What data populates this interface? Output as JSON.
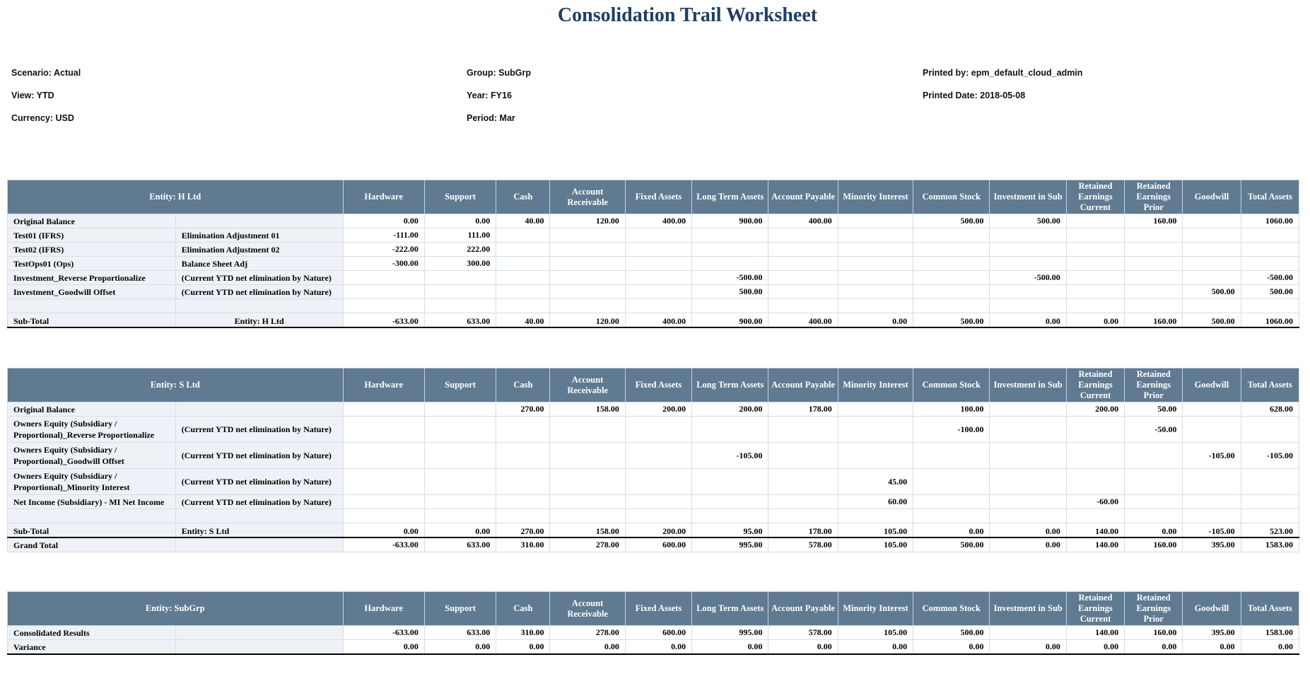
{
  "title": "Consolidation Trail Worksheet",
  "header": {
    "scenario": "Scenario: Actual",
    "view": "View: YTD",
    "currency": "Currency: USD",
    "group": "Group: SubGrp",
    "year": "Year: FY16",
    "period": "Period: Mar",
    "printed_by": "Printed by: epm_default_cloud_admin",
    "printed_date": "Printed Date: 2018-05-08"
  },
  "columns": [
    "Hardware",
    "Support",
    "Cash",
    "Account Receivable",
    "Fixed Assets",
    "Long Term Assets",
    "Account Payable",
    "Minority Interest",
    "Common Stock",
    "Investment in Sub",
    "Retained Earnings Current",
    "Retained Earnings Prior",
    "Goodwill",
    "Total Assets"
  ],
  "tables": [
    {
      "entity": "Entity: H Ltd",
      "rows": [
        {
          "label": "Original Balance",
          "desc": "",
          "values": [
            "0.00",
            "0.00",
            "40.00",
            "120.00",
            "400.00",
            "900.00",
            "400.00",
            "",
            "500.00",
            "500.00",
            "",
            "160.00",
            "",
            "1060.00"
          ]
        },
        {
          "label": "Test01 (IFRS)",
          "desc": "Elimination Adjustment 01",
          "values": [
            "-111.00",
            "111.00",
            "",
            "",
            "",
            "",
            "",
            "",
            "",
            "",
            "",
            "",
            "",
            ""
          ]
        },
        {
          "label": "Test02 (IFRS)",
          "desc": "Elimination Adjustment 02",
          "values": [
            "-222.00",
            "222.00",
            "",
            "",
            "",
            "",
            "",
            "",
            "",
            "",
            "",
            "",
            "",
            ""
          ]
        },
        {
          "label": "TestOps01 (Ops)",
          "desc": "Balance Sheet Adj",
          "values": [
            "-300.00",
            "300.00",
            "",
            "",
            "",
            "",
            "",
            "",
            "",
            "",
            "",
            "",
            "",
            ""
          ]
        },
        {
          "label": "Investment_Reverse Proportionalize",
          "desc": "(Current YTD net elimination by Nature)",
          "values": [
            "",
            "",
            "",
            "",
            "",
            "-500.00",
            "",
            "",
            "",
            "-500.00",
            "",
            "",
            "",
            "-500.00"
          ]
        },
        {
          "label": "Investment_Goodwill Offset",
          "desc": "(Current YTD net elimination by Nature)",
          "values": [
            "",
            "",
            "",
            "",
            "",
            "500.00",
            "",
            "",
            "",
            "",
            "",
            "",
            "500.00",
            "500.00"
          ]
        }
      ],
      "subtotal": {
        "label": "Sub-Total",
        "desc": "Entity: H Ltd",
        "values": [
          "-633.00",
          "633.00",
          "40.00",
          "120.00",
          "400.00",
          "900.00",
          "400.00",
          "0.00",
          "500.00",
          "0.00",
          "0.00",
          "160.00",
          "500.00",
          "1060.00"
        ]
      }
    },
    {
      "entity": "Entity: S Ltd",
      "rows": [
        {
          "label": "Original Balance",
          "desc": "",
          "values": [
            "",
            "",
            "270.00",
            "158.00",
            "200.00",
            "200.00",
            "178.00",
            "",
            "100.00",
            "",
            "200.00",
            "50.00",
            "",
            "628.00"
          ]
        },
        {
          "label": "Owners Equity (Subsidiary / Proportional)_Reverse Proportionalize",
          "desc": "(Current YTD net elimination by Nature)",
          "values": [
            "",
            "",
            "",
            "",
            "",
            "",
            "",
            "",
            "-100.00",
            "",
            "",
            "-50.00",
            "",
            ""
          ]
        },
        {
          "label": "Owners Equity (Subsidiary / Proportional)_Goodwill Offset",
          "desc": "(Current YTD net elimination by Nature)",
          "values": [
            "",
            "",
            "",
            "",
            "",
            "-105.00",
            "",
            "",
            "",
            "",
            "",
            "",
            "-105.00",
            "-105.00"
          ]
        },
        {
          "label": "Owners Equity (Subsidiary / Proportional)_Minority Interest",
          "desc": "(Current YTD net elimination by Nature)",
          "values": [
            "",
            "",
            "",
            "",
            "",
            "",
            "",
            "45.00",
            "",
            "",
            "",
            "",
            "",
            ""
          ]
        },
        {
          "label": "Net Income (Subsidiary) - MI Net Income",
          "desc": "(Current YTD net elimination by Nature)",
          "values": [
            "",
            "",
            "",
            "",
            "",
            "",
            "",
            "60.00",
            "",
            "",
            "-60.00",
            "",
            "",
            ""
          ]
        }
      ],
      "subtotal": {
        "label": "Sub-Total",
        "desc": "Entity: S Ltd",
        "values": [
          "0.00",
          "0.00",
          "270.00",
          "158.00",
          "200.00",
          "95.00",
          "178.00",
          "105.00",
          "0.00",
          "0.00",
          "140.00",
          "0.00",
          "-105.00",
          "523.00"
        ]
      },
      "grandtotal": {
        "label": "Grand Total",
        "desc": "",
        "values": [
          "-633.00",
          "633.00",
          "310.00",
          "278.00",
          "600.00",
          "995.00",
          "578.00",
          "105.00",
          "500.00",
          "0.00",
          "140.00",
          "160.00",
          "395.00",
          "1583.00"
        ]
      }
    },
    {
      "entity": "Entity: SubGrp",
      "rows": [
        {
          "label": "Consolidated Results",
          "desc": "",
          "values": [
            "-633.00",
            "633.00",
            "310.00",
            "278.00",
            "600.00",
            "995.00",
            "578.00",
            "105.00",
            "500.00",
            "",
            "140.00",
            "160.00",
            "395.00",
            "1583.00"
          ]
        },
        {
          "label": "Variance",
          "desc": "",
          "values": [
            "0.00",
            "0.00",
            "0.00",
            "0.00",
            "0.00",
            "0.00",
            "0.00",
            "0.00",
            "0.00",
            "0.00",
            "0.00",
            "0.00",
            "0.00",
            "0.00"
          ]
        }
      ]
    }
  ]
}
